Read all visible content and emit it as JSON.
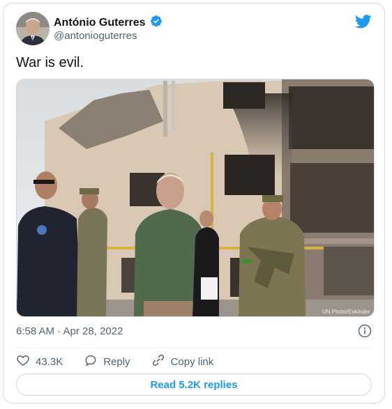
{
  "author": {
    "name": "António Guterres",
    "handle": "@antonioguterres",
    "verified": true
  },
  "tweet": {
    "text": "War is evil.",
    "timestamp": "6:58 AM · Apr 28, 2022",
    "photo_credit": "UN Photo/Eskinder"
  },
  "actions": {
    "likes_count": "43.3K",
    "reply_label": "Reply",
    "copy_link_label": "Copy link"
  },
  "read_replies_label": "Read 5.2K replies",
  "icons": {
    "verified": "verified-badge-icon",
    "brand": "twitter-bird-icon",
    "info": "info-icon",
    "like": "heart-icon",
    "reply": "speech-bubble-icon",
    "copy_link": "link-icon"
  },
  "colors": {
    "accent": "#1d9bf0",
    "text": "#0f1419",
    "secondary": "#536471",
    "border": "#cfd9de"
  }
}
